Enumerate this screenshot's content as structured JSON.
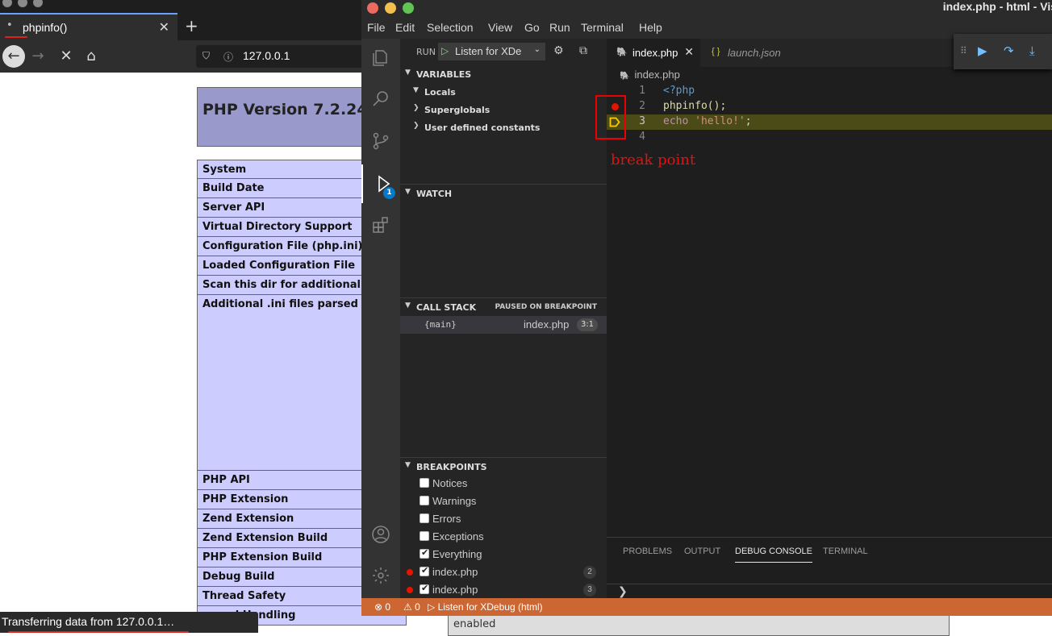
{
  "browser": {
    "tab_title": "phpinfo()",
    "tab_dot": "•",
    "url": "127.0.0.1",
    "status_text": "Transferring data from 127.0.0.1…",
    "page": {
      "heading": "PHP Version 7.2.24-",
      "rows": [
        "System",
        "Build Date",
        "Server API",
        "Virtual Directory Support",
        "Configuration File (php.ini) Pa",
        "Loaded Configuration File",
        "Scan this dir for additional .in",
        "Additional .ini files parsed",
        "PHP API",
        "PHP Extension",
        "Zend Extension",
        "Zend Extension Build",
        "PHP Extension Build",
        "Debug Build",
        "Thread Safety",
        "al Handling"
      ],
      "value_cell": "enabled"
    }
  },
  "vscode": {
    "window_title": "index.php - html - Vis",
    "menu": [
      "File",
      "Edit",
      "Selection",
      "View",
      "Go",
      "Run",
      "Terminal",
      "Help"
    ],
    "activity_badge": "1",
    "run_label": "RUN",
    "run_config": "Listen for XDe",
    "sections": {
      "variables": "VARIABLES",
      "watch": "WATCH",
      "call_stack": "CALL STACK",
      "call_stack_state": "PAUSED ON BREAKPOINT",
      "breakpoints": "BREAKPOINTS"
    },
    "variables": [
      "Locals",
      "Superglobals",
      "User defined constants"
    ],
    "call_stack": {
      "fn": "{main}",
      "file": "index.php",
      "pos": "3:1"
    },
    "breakpoints": [
      {
        "label": "Notices",
        "checked": false,
        "dot": false,
        "count": ""
      },
      {
        "label": "Warnings",
        "checked": false,
        "dot": false,
        "count": ""
      },
      {
        "label": "Errors",
        "checked": false,
        "dot": false,
        "count": ""
      },
      {
        "label": "Exceptions",
        "checked": false,
        "dot": false,
        "count": ""
      },
      {
        "label": "Everything",
        "checked": true,
        "dot": false,
        "count": ""
      },
      {
        "label": "index.php",
        "checked": true,
        "dot": true,
        "count": "2"
      },
      {
        "label": "index.php",
        "checked": true,
        "dot": true,
        "count": "3"
      }
    ],
    "tabs": [
      {
        "label": "index.php",
        "icon": "🐘"
      },
      {
        "label": "launch.json",
        "icon": "{ }"
      }
    ],
    "breadcrumb": "index.php",
    "code": [
      {
        "ln": "1",
        "text": "<?php"
      },
      {
        "ln": "2",
        "text": "phpinfo();"
      },
      {
        "ln": "3",
        "text_a": "echo ",
        "text_b": "'hello!'",
        "text_c": ";"
      },
      {
        "ln": "4",
        "text": ""
      }
    ],
    "annotation": "break point",
    "panel_tabs": [
      "PROBLEMS",
      "OUTPUT",
      "DEBUG CONSOLE",
      "TERMINAL"
    ],
    "panel_prompt": "❯",
    "status": {
      "errors": "⊗ 0",
      "warnings": "⚠ 0",
      "debug": "▷ Listen for XDebug (html)"
    },
    "colors": {
      "status_bar": "#cc6633",
      "breakpoint": "#e51400",
      "annotation": "#e61010"
    }
  }
}
